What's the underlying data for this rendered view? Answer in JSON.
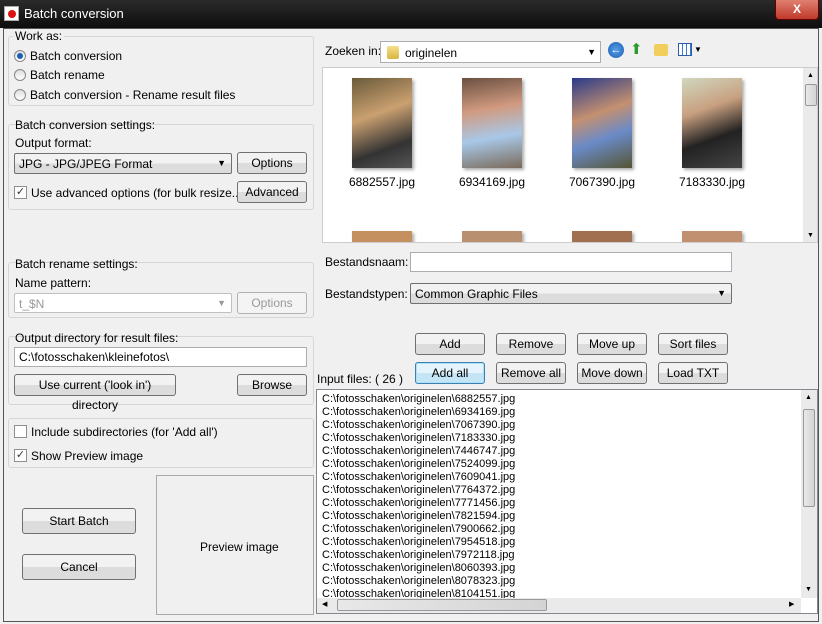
{
  "window": {
    "title": "Batch conversion",
    "close": "X"
  },
  "work_as": {
    "legend": "Work as:",
    "options": [
      {
        "label": "Batch conversion",
        "selected": true
      },
      {
        "label": "Batch rename",
        "selected": false
      },
      {
        "label": "Batch conversion - Rename result files",
        "selected": false
      }
    ]
  },
  "conversion": {
    "legend": "Batch conversion settings:",
    "output_format_label": "Output format:",
    "output_format": "JPG - JPG/JPEG Format",
    "options_button": "Options",
    "advanced_checkbox": "Use advanced options (for bulk resize...)",
    "advanced_checked": true,
    "advanced_button": "Advanced"
  },
  "rename": {
    "legend": "Batch rename settings:",
    "name_pattern_label": "Name pattern:",
    "name_pattern": "t_$N",
    "options_button": "Options"
  },
  "output_dir": {
    "legend": "Output directory for result files:",
    "value": "C:\\fotosschaken\\kleinefotos\\",
    "use_current_button": "Use current ('look in') directory",
    "browse_button": "Browse"
  },
  "misc": {
    "include_subdirs": "Include subdirectories (for 'Add all')",
    "include_subdirs_checked": false,
    "show_preview": "Show Preview image",
    "show_preview_checked": true
  },
  "actions": {
    "start": "Start Batch",
    "cancel": "Cancel"
  },
  "preview": {
    "label": "Preview image"
  },
  "browser": {
    "look_in_label": "Zoeken in:",
    "look_in_value": "originelen",
    "icons": [
      "back-icon",
      "up-folder-icon",
      "new-folder-icon",
      "view-menu-icon"
    ],
    "files": [
      "6882557.jpg",
      "6934169.jpg",
      "7067390.jpg",
      "7183330.jpg"
    ],
    "filename_label": "Bestandsnaam:",
    "filename_value": "",
    "filetype_label": "Bestandstypen:",
    "filetype_value": "Common Graphic Files"
  },
  "buttons": {
    "add": "Add",
    "remove": "Remove",
    "move_up": "Move up",
    "sort_files": "Sort files",
    "add_all": "Add all",
    "remove_all": "Remove all",
    "move_down": "Move down",
    "load_txt": "Load TXT"
  },
  "input_files": {
    "label": "Input files: ( 26 )",
    "items": [
      "C:\\fotosschaken\\originelen\\6882557.jpg",
      "C:\\fotosschaken\\originelen\\6934169.jpg",
      "C:\\fotosschaken\\originelen\\7067390.jpg",
      "C:\\fotosschaken\\originelen\\7183330.jpg",
      "C:\\fotosschaken\\originelen\\7446747.jpg",
      "C:\\fotosschaken\\originelen\\7524099.jpg",
      "C:\\fotosschaken\\originelen\\7609041.jpg",
      "C:\\fotosschaken\\originelen\\7764372.jpg",
      "C:\\fotosschaken\\originelen\\7771456.jpg",
      "C:\\fotosschaken\\originelen\\7821594.jpg",
      "C:\\fotosschaken\\originelen\\7900662.jpg",
      "C:\\fotosschaken\\originelen\\7954518.jpg",
      "C:\\fotosschaken\\originelen\\7972118.jpg",
      "C:\\fotosschaken\\originelen\\8060393.jpg",
      "C:\\fotosschaken\\originelen\\8078323.jpg",
      "C:\\fotosschaken\\originelen\\8104151.jpg"
    ]
  }
}
